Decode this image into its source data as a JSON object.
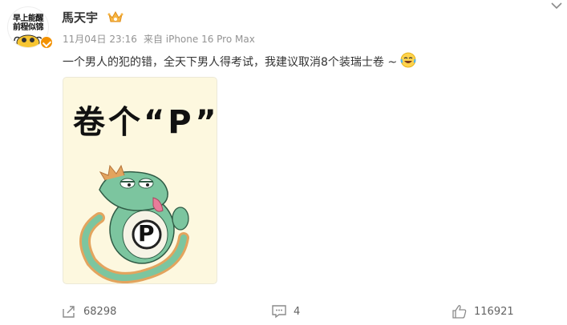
{
  "user": {
    "avatar_text": "早上能醒\n前程似锦",
    "name": "馬天宇",
    "crown_icon": "crown-icon",
    "verify_icon": "verified-badge-icon"
  },
  "meta": {
    "time": "11月04日 23:16",
    "source": "来自 iPhone 16 Pro Max"
  },
  "post": {
    "text": "一个男人的犯的错，全天下男人得考试，我建议取消8个装瑞士卷 ~",
    "emoji": "laugh-tears-icon"
  },
  "image": {
    "caption": "卷个“P”",
    "character_letter": "P",
    "colors": {
      "background": "#fdf8df",
      "dragon": "#7cc59f",
      "spikes": "#e3a45e"
    }
  },
  "actions": {
    "repost": {
      "icon": "share-icon",
      "count": "68298"
    },
    "comment": {
      "icon": "comment-icon",
      "count": "4"
    },
    "like": {
      "icon": "thumbs-up-icon",
      "count": "116921"
    }
  }
}
